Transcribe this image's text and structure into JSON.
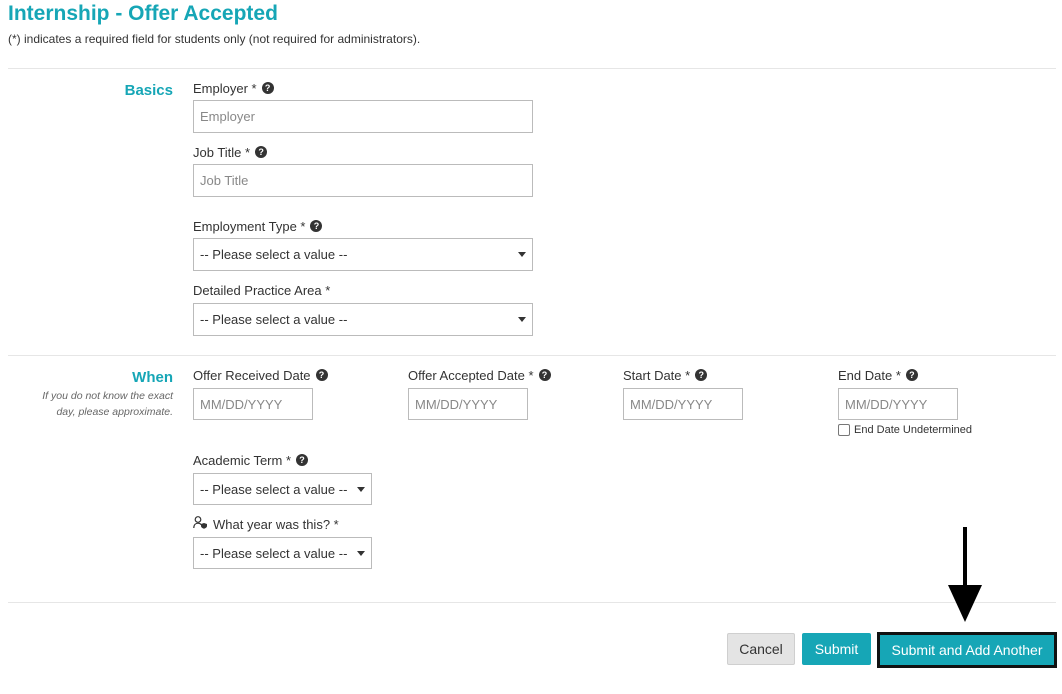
{
  "page": {
    "title": "Internship - Offer Accepted",
    "subtitle": "(*) indicates a required field for students only (not required for administrators)."
  },
  "basics": {
    "section_label": "Basics",
    "employer": {
      "label": "Employer *",
      "placeholder": "Employer"
    },
    "job_title": {
      "label": "Job Title *",
      "placeholder": "Job Title"
    },
    "employment_type": {
      "label": "Employment Type *",
      "selected": "-- Please select a value --"
    },
    "practice_area": {
      "label": "Detailed Practice Area *",
      "selected": "-- Please select a value --"
    }
  },
  "when": {
    "section_label": "When",
    "hint": "If you do not know the exact day, please approximate.",
    "offer_received": {
      "label": "Offer Received Date",
      "placeholder": "MM/DD/YYYY"
    },
    "offer_accepted": {
      "label": "Offer Accepted Date *",
      "placeholder": "MM/DD/YYYY"
    },
    "start_date": {
      "label": "Start Date *",
      "placeholder": "MM/DD/YYYY"
    },
    "end_date": {
      "label": "End Date *",
      "placeholder": "MM/DD/YYYY"
    },
    "end_undetermined": {
      "label": "End Date Undetermined",
      "checked": false
    },
    "academic_term": {
      "label": "Academic Term *",
      "selected": "-- Please select a value --"
    },
    "year": {
      "label": "What year was this? *",
      "selected": "-- Please select a value --"
    }
  },
  "actions": {
    "cancel": "Cancel",
    "submit": "Submit",
    "submit_add": "Submit and Add Another"
  },
  "icons": {
    "help": "question-circle-icon",
    "caret": "caret-down-icon",
    "user": "user-shield-icon",
    "annotation": "down-arrow-annotation"
  },
  "colors": {
    "accent": "#16a6b6",
    "text": "#333333",
    "cancel_bg": "#e4e4e4"
  }
}
